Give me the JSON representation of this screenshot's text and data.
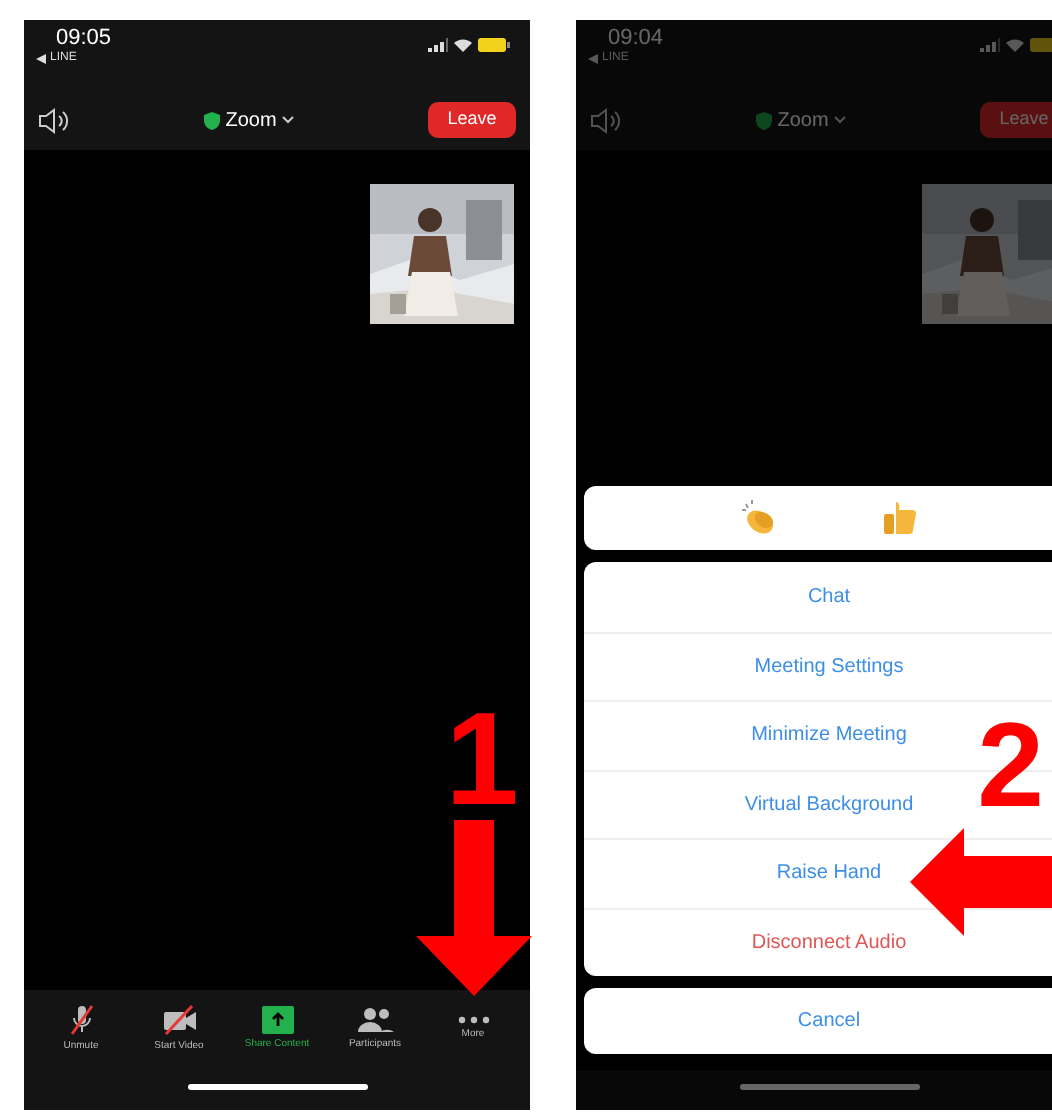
{
  "screens": [
    {
      "time": "09:05",
      "back_app": "LINE",
      "meeting_title": "Zoom",
      "leave_label": "Leave",
      "dimmed": false,
      "toolbar": [
        {
          "kind": "mic-muted",
          "label": "Unmute"
        },
        {
          "kind": "video-off",
          "label": "Start Video"
        },
        {
          "kind": "share",
          "label": "Share Content"
        },
        {
          "kind": "participants",
          "label": "Participants"
        },
        {
          "kind": "more",
          "label": "More"
        }
      ]
    },
    {
      "time": "09:04",
      "back_app": "LINE",
      "meeting_title": "Zoom",
      "leave_label": "Leave",
      "dimmed": true,
      "sheet": {
        "reactions": [
          {
            "kind": "clap"
          },
          {
            "kind": "thumbs-up"
          }
        ],
        "items": [
          {
            "label": "Chat",
            "kind": "normal"
          },
          {
            "label": "Meeting Settings",
            "kind": "normal"
          },
          {
            "label": "Minimize Meeting",
            "kind": "normal"
          },
          {
            "label": "Virtual Background",
            "kind": "normal"
          },
          {
            "label": "Raise Hand",
            "kind": "normal"
          },
          {
            "label": "Disconnect Audio",
            "kind": "destructive"
          }
        ],
        "cancel_label": "Cancel"
      }
    }
  ],
  "steps": [
    {
      "number": "1",
      "kind": "down"
    },
    {
      "number": "2",
      "kind": "left"
    }
  ]
}
